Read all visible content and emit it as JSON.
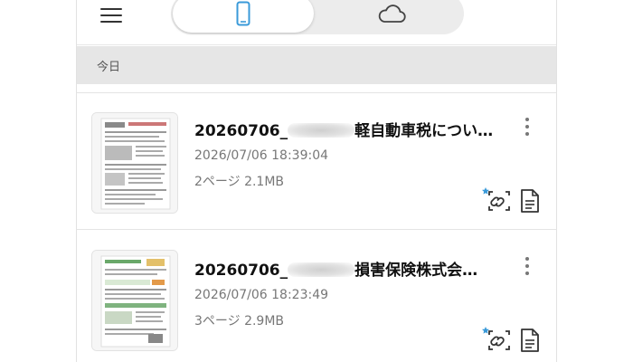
{
  "topbar": {
    "tabs": [
      {
        "icon": "smartphone-icon",
        "active": true
      },
      {
        "icon": "cloud-icon",
        "active": false
      }
    ]
  },
  "section": {
    "label": "今日"
  },
  "colors": {
    "accent": "#3a9ad9",
    "section_bg": "#e6e6e6",
    "meta_text": "#777777"
  },
  "items": [
    {
      "title_prefix": "20260706_",
      "title_suffix": "軽自動車税につい…",
      "date": "2026/07/06 18:39:04",
      "meta": "2ページ 2.1MB"
    },
    {
      "title_prefix": "20260706_",
      "title_suffix": "損害保険株式会…",
      "date": "2026/07/06 18:23:49",
      "meta": "3ページ 2.9MB"
    }
  ]
}
